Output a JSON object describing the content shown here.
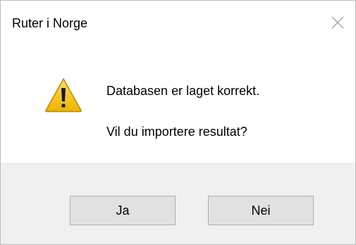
{
  "window": {
    "title": "Ruter i Norge",
    "close_icon": "close-icon"
  },
  "message": {
    "icon": "warning-icon",
    "line1": "Databasen er laget korrekt.",
    "line2": "Vil du importere resultat?"
  },
  "buttons": {
    "yes_label": "Ja",
    "no_label": "Nei"
  },
  "colors": {
    "footer_bg": "#f0f0f0",
    "button_bg": "#e1e1e1",
    "default_button_border": "#0078d7",
    "warning_fill": "#f7c42b"
  }
}
